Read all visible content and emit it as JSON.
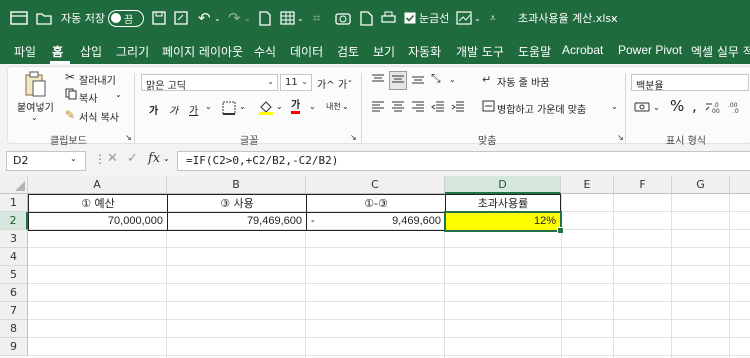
{
  "titlebar": {
    "autosave_label": "자동 저장",
    "autosave_state": "끔",
    "gridlines_label": "눈금선",
    "filename": "초과사용율 계산.xlsx"
  },
  "menu": [
    "파일",
    "홈",
    "삽입",
    "그리기",
    "페이지 레이아웃",
    "수식",
    "데이터",
    "검토",
    "보기",
    "자동화",
    "개발 도구",
    "도움말",
    "Acrobat",
    "Power Pivot",
    "엑셀 실무 적"
  ],
  "ribbon": {
    "clipboard": {
      "paste": "붙여넣기",
      "cut": "잘라내기",
      "copy": "복사",
      "format_painter": "서식 복사",
      "label": "클립보드"
    },
    "font": {
      "name": "맑은 고딕",
      "size": "11",
      "label": "글꼴",
      "grow": "가^",
      "shrink": "가ˇ",
      "bold": "가",
      "italic": "가",
      "underline": "가",
      "color_letter": "가",
      "phonetic": "내천"
    },
    "align": {
      "wrap": "자동 줄 바꿈",
      "merge": "병합하고 가운데 맞춤",
      "label": "맞춤"
    },
    "number": {
      "format": "백분율",
      "percent": "%",
      "comma": ",",
      "label": "표시 형식"
    }
  },
  "formula_bar": {
    "namebox": "D2",
    "fx": "fx",
    "formula": "=IF(C2>0,+C2/B2,-C2/B2)"
  },
  "sheet": {
    "columns": [
      "A",
      "B",
      "C",
      "D",
      "E",
      "F",
      "G"
    ],
    "rows": [
      "1",
      "2",
      "3",
      "4",
      "5",
      "6",
      "7",
      "8",
      "9"
    ],
    "header_row": [
      "① 예산",
      "③ 사용",
      "①-③",
      "초과사용률"
    ],
    "data_row": {
      "a": "70,000,000",
      "b": "79,469,600",
      "c_sign": "-",
      "c": "9,469,600",
      "d": "12%"
    }
  },
  "colors": {
    "accent": "#1f6b3d",
    "selection": "#217346",
    "highlight": "#ffff00"
  }
}
